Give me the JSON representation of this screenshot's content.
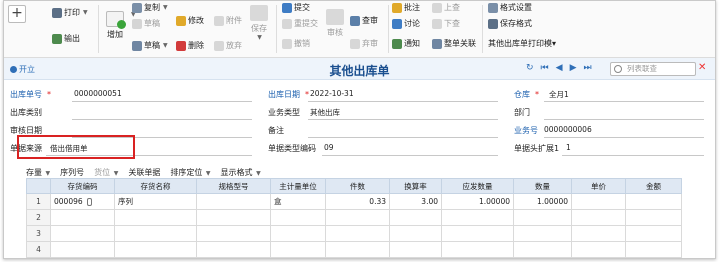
{
  "toolbar": {
    "print": "打印",
    "export": "输出",
    "add": "增加",
    "copy": "复制",
    "draft_top": "草稿",
    "draft": "草稿",
    "modify": "修改",
    "delete": "删除",
    "attachment": "附件",
    "discard": "放弃",
    "save": "保存",
    "submit": "提交",
    "resubmit": "重提交",
    "revoke": "撤销",
    "audit": "审核",
    "audit_query": "查审",
    "abandon": "弃审",
    "approve": "批注",
    "discuss": "讨论",
    "notify": "通知",
    "prev": "上查",
    "next": "下查",
    "relate": "整单关联",
    "format_set": "格式设置",
    "save_format": "保存格式",
    "template": "其他出库单打印模▾"
  },
  "header": {
    "open": "开立",
    "title": "其他出库单",
    "search_placeholder": "列表联查"
  },
  "form": {
    "out_no_label": "出库单号",
    "out_no": "0000000051",
    "out_date_label": "出库日期",
    "out_date": "2022-10-31",
    "warehouse_label": "仓库",
    "warehouse": "全月1",
    "out_type_label": "出库类别",
    "biz_type_label": "业务类型",
    "biz_type": "其他出库",
    "dept_label": "部门",
    "audit_date_label": "审核日期",
    "remark_label": "备注",
    "biz_no_label": "业务号",
    "biz_no": "0000000006",
    "source_label": "单据来源",
    "source": "借出借用单",
    "type_code_label": "单据类型编码",
    "type_code": "09",
    "ext_label": "单据头扩展1",
    "ext": "1"
  },
  "grid_toolbar": {
    "stock": "存量",
    "serial": "序列号",
    "location": "货位",
    "link": "关联单据",
    "sort": "排序定位",
    "display": "显示格式"
  },
  "grid": {
    "columns": [
      "存货编码",
      "存货名称",
      "规格型号",
      "主计量单位",
      "件数",
      "换算率",
      "应发数量",
      "数量",
      "单价",
      "金额"
    ],
    "rows": [
      {
        "no": "1",
        "code": "000096",
        "name": "序列",
        "spec": "",
        "unit": "盒",
        "pieces": "0.33",
        "rate": "3.00",
        "due_qty": "1.00000",
        "qty": "1.00000",
        "price": "",
        "amount": ""
      },
      {
        "no": "2",
        "code": "",
        "name": "",
        "spec": "",
        "unit": "",
        "pieces": "",
        "rate": "",
        "due_qty": "",
        "qty": "",
        "price": "",
        "amount": ""
      },
      {
        "no": "3",
        "code": "",
        "name": "",
        "spec": "",
        "unit": "",
        "pieces": "",
        "rate": "",
        "due_qty": "",
        "qty": "",
        "price": "",
        "amount": ""
      },
      {
        "no": "4",
        "code": "",
        "name": "",
        "spec": "",
        "unit": "",
        "pieces": "",
        "rate": "",
        "due_qty": "",
        "qty": "",
        "price": "",
        "amount": ""
      }
    ]
  },
  "colors": {
    "accent": "#1b4f8f",
    "highlight": "#d92222"
  }
}
